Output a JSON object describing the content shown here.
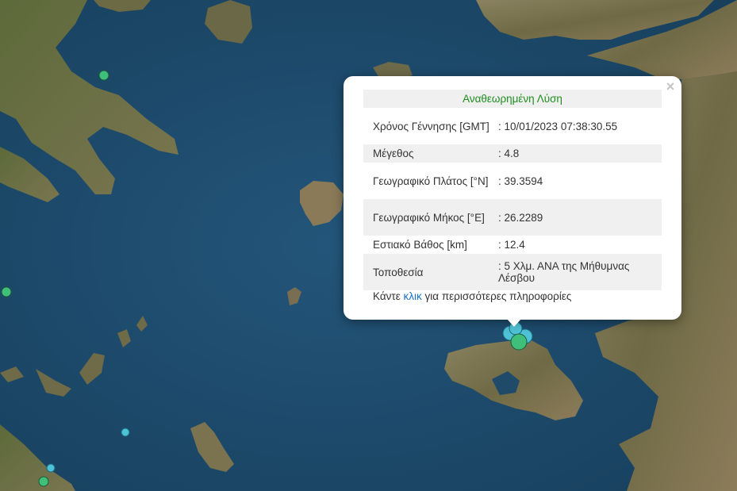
{
  "popup": {
    "title": "Αναθεωρημένη Λύση",
    "close_label": "×",
    "rows": [
      {
        "label": "Χρόνος Γέννησης [GMT]",
        "value": ": 10/01/2023 07:38:30.55"
      },
      {
        "label": "Μέγεθος",
        "value": ": 4.8"
      },
      {
        "label": "Γεωγραφικό Πλάτος [°N]",
        "value": ": 39.3594"
      },
      {
        "label": "Γεωγραφικό Μήκος [°E]",
        "value": ": 26.2289"
      },
      {
        "label": "Εστιακό Βάθος [km]",
        "value": ": 12.4"
      },
      {
        "label": "Τοποθεσία",
        "value": ": 5 Χλμ. ΑΝΑ της Μήθυμνας Λέσβου"
      }
    ],
    "footer_prefix": "Κάντε",
    "footer_link": "κλικ",
    "footer_suffix": "για περισσότερες πληροφορίες"
  },
  "map": {
    "sea_color": "#1e4b6b",
    "land_color": "#7d7553",
    "marker_colors": {
      "cyan": "#4fc3d6",
      "green": "#3fbf7a"
    },
    "marker_icon": "earthquake-epicenter-marker"
  }
}
